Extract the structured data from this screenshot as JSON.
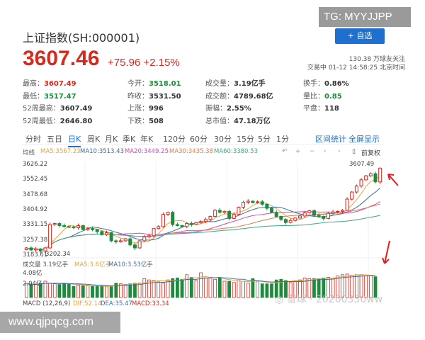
{
  "header": {
    "title": "上证指数(SH:000001)",
    "price": "3607.46",
    "change": "+75.96",
    "change_pct": "+2.15%",
    "add_button": "+ 自选",
    "followers": "130.38 万球友关注",
    "status": "交易中 01-12 14:58:25 北京时间"
  },
  "stats": [
    {
      "label": "最高：",
      "value": "3607.49",
      "color": "red"
    },
    {
      "label": "今开：",
      "value": "3518.01",
      "color": "green"
    },
    {
      "label": "成交量：",
      "value": "3.19亿手"
    },
    {
      "label": "换手：",
      "value": "0.86%"
    },
    {
      "label": "最低：",
      "value": "3517.47",
      "color": "green"
    },
    {
      "label": "昨收：",
      "value": "3531.50"
    },
    {
      "label": "成交额：",
      "value": "4789.68亿"
    },
    {
      "label": "量比：",
      "value": "0.85",
      "color": "green"
    },
    {
      "label": "52周最高：",
      "value": "3607.49"
    },
    {
      "label": "上涨：",
      "value": "996"
    },
    {
      "label": "振幅：",
      "value": "2.55%"
    },
    {
      "label": "平盘：",
      "value": "118"
    },
    {
      "label": "52周最低：",
      "value": "2646.80"
    },
    {
      "label": "下跌：",
      "value": "508"
    },
    {
      "label": "总市值：",
      "value": "47.18万亿"
    }
  ],
  "tabs": [
    "分时",
    "五日",
    "日K",
    "周K",
    "月K",
    "季K",
    "年K",
    "120分",
    "60分",
    "30分",
    "15分",
    "5分",
    "1分"
  ],
  "active_tab": "日K",
  "tab_actions": [
    "区间统计",
    "全屏显示"
  ],
  "ma_legend": {
    "label": "均线",
    "ma5": "MA5:3567.23",
    "ma10": "MA10:3513.43",
    "ma20": "MA20:3449.25",
    "ma30": "MA30:3435.38",
    "ma60": "MA60:3380.53"
  },
  "toolbar": {
    "adjust": "前复权"
  },
  "price_axis": [
    "3626.22",
    "3552.45",
    "3478.68",
    "3404.92",
    "3331.15",
    "3257.38",
    "3183.61"
  ],
  "high_label": "3607.49",
  "low_label": "3202.34",
  "volume_legend": {
    "label": "成交量 3.19亿手",
    "ma5": "MA5:3.6亿手",
    "ma10": "MA10:3.53亿手",
    "axis": [
      "4.08亿",
      "2.04亿"
    ]
  },
  "macd_legend": {
    "label": "MACD (12,26,9)",
    "dif": "DIF:52.14",
    "dea": "DEA:35.47",
    "macd": "MACD:33.34"
  },
  "colors": {
    "up": "#d62a1e",
    "down": "#1e8a3c",
    "ma5": "#e8a33a",
    "ma10": "#3a6fa8",
    "ma20": "#c84fb5",
    "ma30": "#e07a4a",
    "ma60": "#3aa88a"
  },
  "chart_data": {
    "type": "candlestick",
    "ylim": [
      3183.61,
      3626.22
    ],
    "close": [
      3215,
      3205,
      3210,
      3200,
      3215,
      3330,
      3335,
      3325,
      3320,
      3318,
      3315,
      3325,
      3305,
      3310,
      3305,
      3295,
      3280,
      3290,
      3250,
      3245,
      3250,
      3260,
      3230,
      3215,
      3250,
      3270,
      3275,
      3310,
      3320,
      3380,
      3390,
      3330,
      3325,
      3320,
      3335,
      3330,
      3340,
      3345,
      3355,
      3370,
      3400,
      3390,
      3395,
      3360,
      3380,
      3415,
      3440,
      3445,
      3438,
      3442,
      3430,
      3410,
      3390,
      3370,
      3355,
      3340,
      3350,
      3362,
      3372,
      3388,
      3398,
      3375,
      3370,
      3360,
      3385,
      3392,
      3395,
      3400,
      3455,
      3490,
      3520,
      3550,
      3570,
      3580,
      3540,
      3607.46
    ],
    "volume": [
      2.1,
      2.0,
      2.0,
      2.2,
      2.5,
      2.2,
      2.1,
      2.0,
      2.2,
      2.1,
      1.7,
      1.9,
      1.8,
      1.8,
      1.7,
      1.7,
      1.8,
      1.7,
      1.8,
      2.2,
      2.1,
      2.0,
      2.1,
      2.2,
      2.2,
      2.9,
      2.7,
      2.6,
      2.4,
      2.2,
      2.7,
      2.9,
      3.0,
      2.8,
      3.5,
      3.1,
      2.6,
      3.8,
      3.0,
      3.0,
      2.8,
      3.0,
      2.5,
      2.5,
      2.3,
      2.6,
      2.5,
      2.2,
      2.9,
      2.5,
      2.1,
      2.1,
      2.1,
      2.7,
      2.8,
      2.6,
      2.3,
      2.5,
      2.7,
      3.0,
      2.9,
      2.9,
      2.9,
      3.0,
      3.1,
      3.0,
      3.3,
      3.5,
      3.6,
      3.4,
      3.5,
      3.5,
      3.3,
      3.4,
      3.19
    ]
  }
}
